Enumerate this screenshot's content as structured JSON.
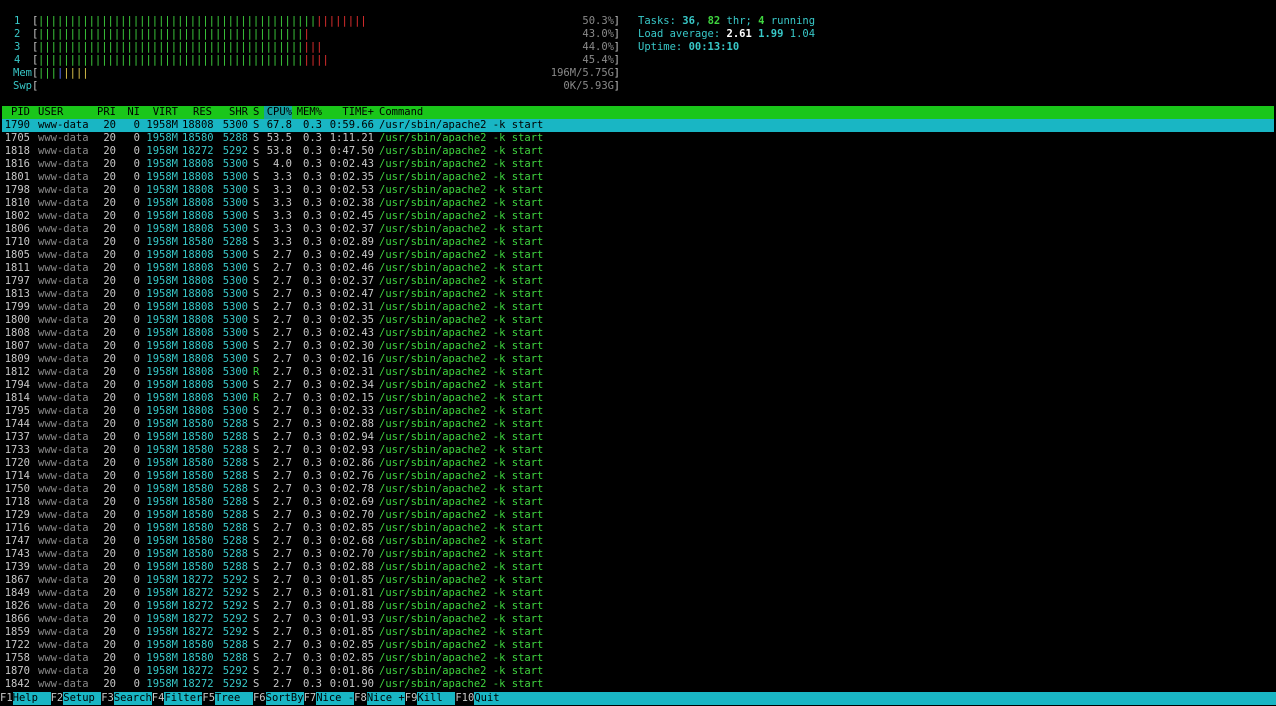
{
  "cpus": [
    {
      "label": "1",
      "green": "||||||||||||||||||||||||||||||||||||||||||||",
      "red": "||||||||",
      "value": "50.3%"
    },
    {
      "label": "2",
      "green": "||||||||||||||||||||||||||||||||||||||||||",
      "red": "|",
      "value": "43.0%"
    },
    {
      "label": "3",
      "green": "||||||||||||||||||||||||||||||||||||||||||",
      "red": "|||",
      "value": "44.0%"
    },
    {
      "label": "4",
      "green": "||||||||||||||||||||||||||||||||||||||||||",
      "red": "||||",
      "value": "45.4%"
    }
  ],
  "mem": {
    "label": "Mem",
    "green": "|||",
    "blue": "|",
    "yellow": "||||",
    "value": "196M/5.75G"
  },
  "swap": {
    "label": "Swp",
    "value": "0K/5.93G"
  },
  "tasks": {
    "label": "Tasks: ",
    "count": "36",
    "sep": ", ",
    "threads": "82",
    "thr_label": " thr; ",
    "running": "4",
    "running_label": " running"
  },
  "load": {
    "label": "Load average: ",
    "l1": "2.61",
    "l5": "1.99",
    "l15": "1.04"
  },
  "uptime": {
    "label": "Uptime: ",
    "value": "00:13:10"
  },
  "columns": {
    "pid": "PID",
    "user": "USER",
    "pri": "PRI",
    "ni": "NI",
    "virt": "VIRT",
    "res": "RES",
    "shr": "SHR",
    "s": "S",
    "cpu": "CPU%",
    "mem": "MEM%",
    "time": "TIME+",
    "command": "Command"
  },
  "processes": [
    {
      "pid": "1790",
      "user": "www-data",
      "pri": "20",
      "ni": "0",
      "virt": "1958M",
      "res": "18808",
      "shr": "5300",
      "s": "S",
      "cpu": "67.8",
      "mem": "0.3",
      "time": "0:59.66",
      "cmd": "/usr/sbin/apache2 -k start"
    },
    {
      "pid": "1705",
      "user": "www-data",
      "pri": "20",
      "ni": "0",
      "virt": "1958M",
      "res": "18580",
      "shr": "5288",
      "s": "S",
      "cpu": "53.5",
      "mem": "0.3",
      "time": "1:11.21",
      "cmd": "/usr/sbin/apache2 -k start"
    },
    {
      "pid": "1818",
      "user": "www-data",
      "pri": "20",
      "ni": "0",
      "virt": "1958M",
      "res": "18272",
      "shr": "5292",
      "s": "S",
      "cpu": "53.8",
      "mem": "0.3",
      "time": "0:47.50",
      "cmd": "/usr/sbin/apache2 -k start"
    },
    {
      "pid": "1816",
      "user": "www-data",
      "pri": "20",
      "ni": "0",
      "virt": "1958M",
      "res": "18808",
      "shr": "5300",
      "s": "S",
      "cpu": "4.0",
      "mem": "0.3",
      "time": "0:02.43",
      "cmd": "/usr/sbin/apache2 -k start"
    },
    {
      "pid": "1801",
      "user": "www-data",
      "pri": "20",
      "ni": "0",
      "virt": "1958M",
      "res": "18808",
      "shr": "5300",
      "s": "S",
      "cpu": "3.3",
      "mem": "0.3",
      "time": "0:02.35",
      "cmd": "/usr/sbin/apache2 -k start"
    },
    {
      "pid": "1798",
      "user": "www-data",
      "pri": "20",
      "ni": "0",
      "virt": "1958M",
      "res": "18808",
      "shr": "5300",
      "s": "S",
      "cpu": "3.3",
      "mem": "0.3",
      "time": "0:02.53",
      "cmd": "/usr/sbin/apache2 -k start"
    },
    {
      "pid": "1810",
      "user": "www-data",
      "pri": "20",
      "ni": "0",
      "virt": "1958M",
      "res": "18808",
      "shr": "5300",
      "s": "S",
      "cpu": "3.3",
      "mem": "0.3",
      "time": "0:02.38",
      "cmd": "/usr/sbin/apache2 -k start"
    },
    {
      "pid": "1802",
      "user": "www-data",
      "pri": "20",
      "ni": "0",
      "virt": "1958M",
      "res": "18808",
      "shr": "5300",
      "s": "S",
      "cpu": "3.3",
      "mem": "0.3",
      "time": "0:02.45",
      "cmd": "/usr/sbin/apache2 -k start"
    },
    {
      "pid": "1806",
      "user": "www-data",
      "pri": "20",
      "ni": "0",
      "virt": "1958M",
      "res": "18808",
      "shr": "5300",
      "s": "S",
      "cpu": "3.3",
      "mem": "0.3",
      "time": "0:02.37",
      "cmd": "/usr/sbin/apache2 -k start"
    },
    {
      "pid": "1710",
      "user": "www-data",
      "pri": "20",
      "ni": "0",
      "virt": "1958M",
      "res": "18580",
      "shr": "5288",
      "s": "S",
      "cpu": "3.3",
      "mem": "0.3",
      "time": "0:02.89",
      "cmd": "/usr/sbin/apache2 -k start"
    },
    {
      "pid": "1805",
      "user": "www-data",
      "pri": "20",
      "ni": "0",
      "virt": "1958M",
      "res": "18808",
      "shr": "5300",
      "s": "S",
      "cpu": "2.7",
      "mem": "0.3",
      "time": "0:02.49",
      "cmd": "/usr/sbin/apache2 -k start"
    },
    {
      "pid": "1811",
      "user": "www-data",
      "pri": "20",
      "ni": "0",
      "virt": "1958M",
      "res": "18808",
      "shr": "5300",
      "s": "S",
      "cpu": "2.7",
      "mem": "0.3",
      "time": "0:02.46",
      "cmd": "/usr/sbin/apache2 -k start"
    },
    {
      "pid": "1797",
      "user": "www-data",
      "pri": "20",
      "ni": "0",
      "virt": "1958M",
      "res": "18808",
      "shr": "5300",
      "s": "S",
      "cpu": "2.7",
      "mem": "0.3",
      "time": "0:02.37",
      "cmd": "/usr/sbin/apache2 -k start"
    },
    {
      "pid": "1813",
      "user": "www-data",
      "pri": "20",
      "ni": "0",
      "virt": "1958M",
      "res": "18808",
      "shr": "5300",
      "s": "S",
      "cpu": "2.7",
      "mem": "0.3",
      "time": "0:02.47",
      "cmd": "/usr/sbin/apache2 -k start"
    },
    {
      "pid": "1799",
      "user": "www-data",
      "pri": "20",
      "ni": "0",
      "virt": "1958M",
      "res": "18808",
      "shr": "5300",
      "s": "S",
      "cpu": "2.7",
      "mem": "0.3",
      "time": "0:02.31",
      "cmd": "/usr/sbin/apache2 -k start"
    },
    {
      "pid": "1800",
      "user": "www-data",
      "pri": "20",
      "ni": "0",
      "virt": "1958M",
      "res": "18808",
      "shr": "5300",
      "s": "S",
      "cpu": "2.7",
      "mem": "0.3",
      "time": "0:02.35",
      "cmd": "/usr/sbin/apache2 -k start"
    },
    {
      "pid": "1808",
      "user": "www-data",
      "pri": "20",
      "ni": "0",
      "virt": "1958M",
      "res": "18808",
      "shr": "5300",
      "s": "S",
      "cpu": "2.7",
      "mem": "0.3",
      "time": "0:02.43",
      "cmd": "/usr/sbin/apache2 -k start"
    },
    {
      "pid": "1807",
      "user": "www-data",
      "pri": "20",
      "ni": "0",
      "virt": "1958M",
      "res": "18808",
      "shr": "5300",
      "s": "S",
      "cpu": "2.7",
      "mem": "0.3",
      "time": "0:02.30",
      "cmd": "/usr/sbin/apache2 -k start"
    },
    {
      "pid": "1809",
      "user": "www-data",
      "pri": "20",
      "ni": "0",
      "virt": "1958M",
      "res": "18808",
      "shr": "5300",
      "s": "S",
      "cpu": "2.7",
      "mem": "0.3",
      "time": "0:02.16",
      "cmd": "/usr/sbin/apache2 -k start"
    },
    {
      "pid": "1812",
      "user": "www-data",
      "pri": "20",
      "ni": "0",
      "virt": "1958M",
      "res": "18808",
      "shr": "5300",
      "s": "R",
      "cpu": "2.7",
      "mem": "0.3",
      "time": "0:02.31",
      "cmd": "/usr/sbin/apache2 -k start"
    },
    {
      "pid": "1794",
      "user": "www-data",
      "pri": "20",
      "ni": "0",
      "virt": "1958M",
      "res": "18808",
      "shr": "5300",
      "s": "S",
      "cpu": "2.7",
      "mem": "0.3",
      "time": "0:02.34",
      "cmd": "/usr/sbin/apache2 -k start"
    },
    {
      "pid": "1814",
      "user": "www-data",
      "pri": "20",
      "ni": "0",
      "virt": "1958M",
      "res": "18808",
      "shr": "5300",
      "s": "R",
      "cpu": "2.7",
      "mem": "0.3",
      "time": "0:02.15",
      "cmd": "/usr/sbin/apache2 -k start"
    },
    {
      "pid": "1795",
      "user": "www-data",
      "pri": "20",
      "ni": "0",
      "virt": "1958M",
      "res": "18808",
      "shr": "5300",
      "s": "S",
      "cpu": "2.7",
      "mem": "0.3",
      "time": "0:02.33",
      "cmd": "/usr/sbin/apache2 -k start"
    },
    {
      "pid": "1744",
      "user": "www-data",
      "pri": "20",
      "ni": "0",
      "virt": "1958M",
      "res": "18580",
      "shr": "5288",
      "s": "S",
      "cpu": "2.7",
      "mem": "0.3",
      "time": "0:02.88",
      "cmd": "/usr/sbin/apache2 -k start"
    },
    {
      "pid": "1737",
      "user": "www-data",
      "pri": "20",
      "ni": "0",
      "virt": "1958M",
      "res": "18580",
      "shr": "5288",
      "s": "S",
      "cpu": "2.7",
      "mem": "0.3",
      "time": "0:02.94",
      "cmd": "/usr/sbin/apache2 -k start"
    },
    {
      "pid": "1733",
      "user": "www-data",
      "pri": "20",
      "ni": "0",
      "virt": "1958M",
      "res": "18580",
      "shr": "5288",
      "s": "S",
      "cpu": "2.7",
      "mem": "0.3",
      "time": "0:02.93",
      "cmd": "/usr/sbin/apache2 -k start"
    },
    {
      "pid": "1720",
      "user": "www-data",
      "pri": "20",
      "ni": "0",
      "virt": "1958M",
      "res": "18580",
      "shr": "5288",
      "s": "S",
      "cpu": "2.7",
      "mem": "0.3",
      "time": "0:02.86",
      "cmd": "/usr/sbin/apache2 -k start"
    },
    {
      "pid": "1714",
      "user": "www-data",
      "pri": "20",
      "ni": "0",
      "virt": "1958M",
      "res": "18580",
      "shr": "5288",
      "s": "S",
      "cpu": "2.7",
      "mem": "0.3",
      "time": "0:02.76",
      "cmd": "/usr/sbin/apache2 -k start"
    },
    {
      "pid": "1750",
      "user": "www-data",
      "pri": "20",
      "ni": "0",
      "virt": "1958M",
      "res": "18580",
      "shr": "5288",
      "s": "S",
      "cpu": "2.7",
      "mem": "0.3",
      "time": "0:02.78",
      "cmd": "/usr/sbin/apache2 -k start"
    },
    {
      "pid": "1718",
      "user": "www-data",
      "pri": "20",
      "ni": "0",
      "virt": "1958M",
      "res": "18580",
      "shr": "5288",
      "s": "S",
      "cpu": "2.7",
      "mem": "0.3",
      "time": "0:02.69",
      "cmd": "/usr/sbin/apache2 -k start"
    },
    {
      "pid": "1729",
      "user": "www-data",
      "pri": "20",
      "ni": "0",
      "virt": "1958M",
      "res": "18580",
      "shr": "5288",
      "s": "S",
      "cpu": "2.7",
      "mem": "0.3",
      "time": "0:02.70",
      "cmd": "/usr/sbin/apache2 -k start"
    },
    {
      "pid": "1716",
      "user": "www-data",
      "pri": "20",
      "ni": "0",
      "virt": "1958M",
      "res": "18580",
      "shr": "5288",
      "s": "S",
      "cpu": "2.7",
      "mem": "0.3",
      "time": "0:02.85",
      "cmd": "/usr/sbin/apache2 -k start"
    },
    {
      "pid": "1747",
      "user": "www-data",
      "pri": "20",
      "ni": "0",
      "virt": "1958M",
      "res": "18580",
      "shr": "5288",
      "s": "S",
      "cpu": "2.7",
      "mem": "0.3",
      "time": "0:02.68",
      "cmd": "/usr/sbin/apache2 -k start"
    },
    {
      "pid": "1743",
      "user": "www-data",
      "pri": "20",
      "ni": "0",
      "virt": "1958M",
      "res": "18580",
      "shr": "5288",
      "s": "S",
      "cpu": "2.7",
      "mem": "0.3",
      "time": "0:02.70",
      "cmd": "/usr/sbin/apache2 -k start"
    },
    {
      "pid": "1739",
      "user": "www-data",
      "pri": "20",
      "ni": "0",
      "virt": "1958M",
      "res": "18580",
      "shr": "5288",
      "s": "S",
      "cpu": "2.7",
      "mem": "0.3",
      "time": "0:02.88",
      "cmd": "/usr/sbin/apache2 -k start"
    },
    {
      "pid": "1867",
      "user": "www-data",
      "pri": "20",
      "ni": "0",
      "virt": "1958M",
      "res": "18272",
      "shr": "5292",
      "s": "S",
      "cpu": "2.7",
      "mem": "0.3",
      "time": "0:01.85",
      "cmd": "/usr/sbin/apache2 -k start"
    },
    {
      "pid": "1849",
      "user": "www-data",
      "pri": "20",
      "ni": "0",
      "virt": "1958M",
      "res": "18272",
      "shr": "5292",
      "s": "S",
      "cpu": "2.7",
      "mem": "0.3",
      "time": "0:01.81",
      "cmd": "/usr/sbin/apache2 -k start"
    },
    {
      "pid": "1826",
      "user": "www-data",
      "pri": "20",
      "ni": "0",
      "virt": "1958M",
      "res": "18272",
      "shr": "5292",
      "s": "S",
      "cpu": "2.7",
      "mem": "0.3",
      "time": "0:01.88",
      "cmd": "/usr/sbin/apache2 -k start"
    },
    {
      "pid": "1866",
      "user": "www-data",
      "pri": "20",
      "ni": "0",
      "virt": "1958M",
      "res": "18272",
      "shr": "5292",
      "s": "S",
      "cpu": "2.7",
      "mem": "0.3",
      "time": "0:01.93",
      "cmd": "/usr/sbin/apache2 -k start"
    },
    {
      "pid": "1859",
      "user": "www-data",
      "pri": "20",
      "ni": "0",
      "virt": "1958M",
      "res": "18272",
      "shr": "5292",
      "s": "S",
      "cpu": "2.7",
      "mem": "0.3",
      "time": "0:01.85",
      "cmd": "/usr/sbin/apache2 -k start"
    },
    {
      "pid": "1722",
      "user": "www-data",
      "pri": "20",
      "ni": "0",
      "virt": "1958M",
      "res": "18580",
      "shr": "5288",
      "s": "S",
      "cpu": "2.7",
      "mem": "0.3",
      "time": "0:02.85",
      "cmd": "/usr/sbin/apache2 -k start"
    },
    {
      "pid": "1758",
      "user": "www-data",
      "pri": "20",
      "ni": "0",
      "virt": "1958M",
      "res": "18580",
      "shr": "5288",
      "s": "S",
      "cpu": "2.7",
      "mem": "0.3",
      "time": "0:02.85",
      "cmd": "/usr/sbin/apache2 -k start"
    },
    {
      "pid": "1870",
      "user": "www-data",
      "pri": "20",
      "ni": "0",
      "virt": "1958M",
      "res": "18272",
      "shr": "5292",
      "s": "S",
      "cpu": "2.7",
      "mem": "0.3",
      "time": "0:01.86",
      "cmd": "/usr/sbin/apache2 -k start"
    },
    {
      "pid": "1842",
      "user": "www-data",
      "pri": "20",
      "ni": "0",
      "virt": "1958M",
      "res": "18272",
      "shr": "5292",
      "s": "S",
      "cpu": "2.7",
      "mem": "0.3",
      "time": "0:01.90",
      "cmd": "/usr/sbin/apache2 -k start"
    }
  ],
  "fkeys": [
    {
      "key": "F1",
      "label": "Help  "
    },
    {
      "key": "F2",
      "label": "Setup "
    },
    {
      "key": "F3",
      "label": "Search"
    },
    {
      "key": "F4",
      "label": "Filter"
    },
    {
      "key": "F5",
      "label": "Tree  "
    },
    {
      "key": "F6",
      "label": "SortBy"
    },
    {
      "key": "F7",
      "label": "Nice -"
    },
    {
      "key": "F8",
      "label": "Nice +"
    },
    {
      "key": "F9",
      "label": "Kill  "
    },
    {
      "key": "F10",
      "label": "Quit"
    }
  ]
}
